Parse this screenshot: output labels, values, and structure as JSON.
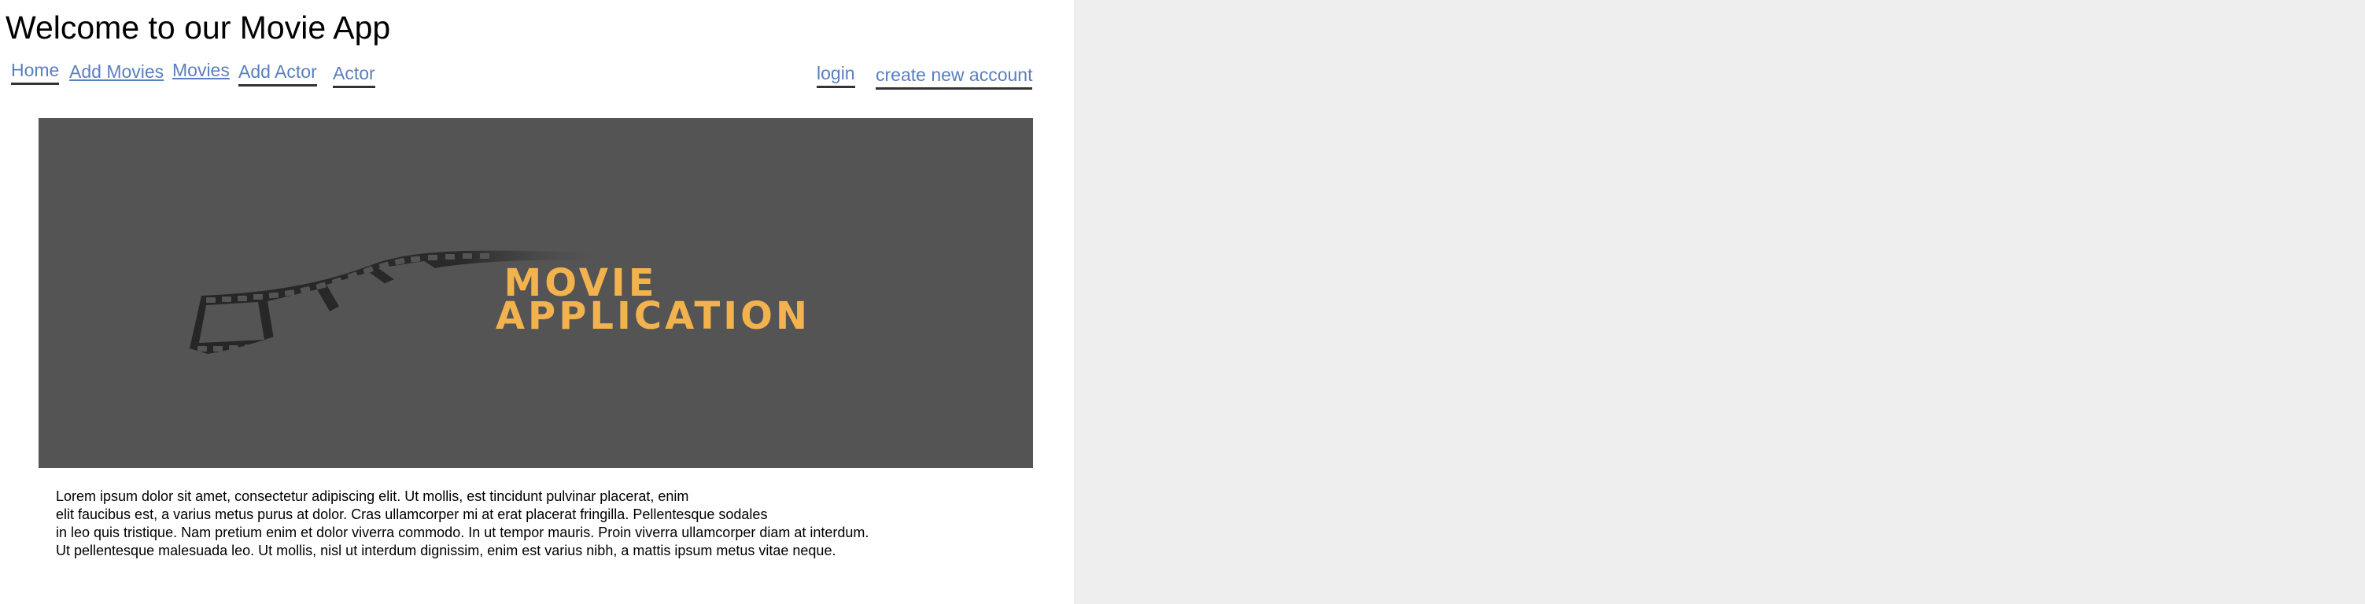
{
  "page": {
    "title": "Welcome to our Movie App"
  },
  "nav": {
    "left": [
      {
        "label": "Home"
      },
      {
        "label": "Add Movies"
      },
      {
        "label": "Movies"
      },
      {
        "label": "Add Actor"
      },
      {
        "label": "Actor"
      }
    ],
    "right": [
      {
        "label": "login"
      },
      {
        "label": "create new account"
      }
    ]
  },
  "banner": {
    "line1": "MOVIE",
    "line2": "APPLICATION",
    "colors": {
      "background": "#545454",
      "text": "#f2b24e",
      "film": "#2a2a2a"
    }
  },
  "intro": {
    "lines": [
      "Lorem ipsum dolor sit amet, consectetur adipiscing elit. Ut mollis, est tincidunt pulvinar placerat, enim",
      "elit faucibus est, a varius metus purus at dolor. Cras ullamcorper mi at erat placerat fringilla. Pellentesque sodales",
      "in leo quis tristique. Nam pretium enim et dolor viverra commodo. In ut tempor mauris. Proin viverra ullamcorper diam at interdum.",
      "Ut pellentesque malesuada leo. Ut mollis, nisl ut interdum dignissim, enim est varius nibh, a mattis ipsum metus vitae neque."
    ]
  },
  "colors": {
    "link": "#5a7fbf",
    "page_background": "#ffffff",
    "outer_background": "#eeeeee"
  }
}
